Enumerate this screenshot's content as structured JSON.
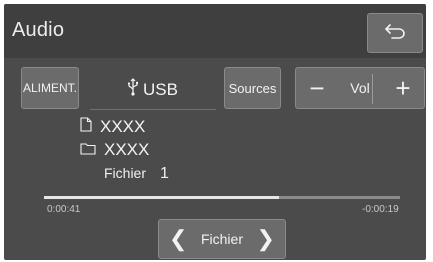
{
  "header": {
    "title": "Audio",
    "back_icon": "back-arrow-icon"
  },
  "source_bar": {
    "aliment_label": "ALIMENT.",
    "source_name": "USB",
    "source_icon": "usb-icon",
    "sources_label": "Sources"
  },
  "volume": {
    "minus": "−",
    "label": "Vol",
    "plus": "+"
  },
  "track": {
    "title": "XXXX",
    "title_icon": "document-icon",
    "folder": "XXXX",
    "folder_icon": "folder-icon",
    "file_label": "Fichier",
    "file_number": "1"
  },
  "progress": {
    "elapsed": "0:00:41",
    "remaining": "-0:00:19",
    "fraction": 0.66
  },
  "file_nav": {
    "prev": "❮",
    "label": "Fichier",
    "next": "❯"
  },
  "colors": {
    "screen_bg": "#4b4b4b",
    "button_bg": "#6b6b6b",
    "text": "#f3f3f3"
  }
}
